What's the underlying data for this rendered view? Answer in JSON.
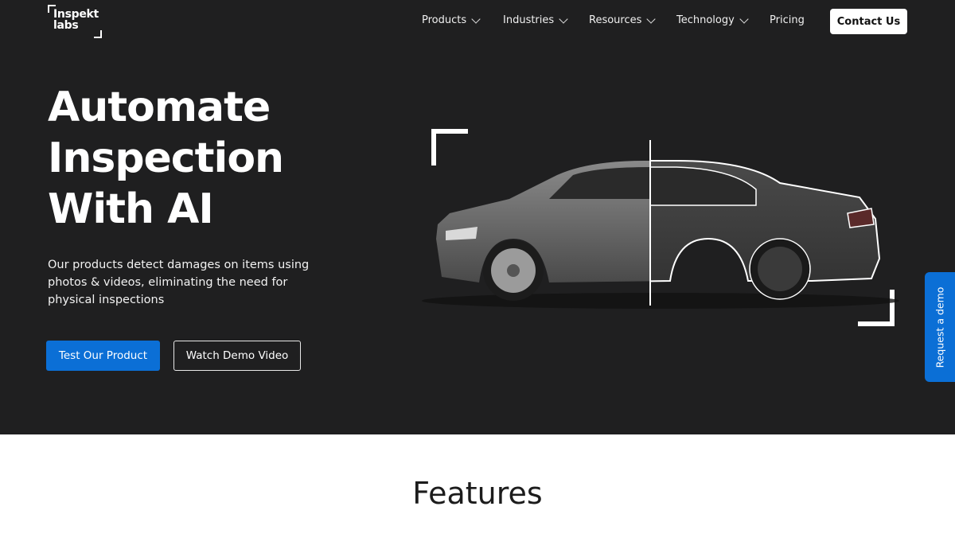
{
  "brand": {
    "logo_text_line1": "Inspekt",
    "logo_text_line2": "labs"
  },
  "nav": {
    "items": [
      {
        "label": "Products",
        "has_dropdown": true
      },
      {
        "label": "Industries",
        "has_dropdown": true
      },
      {
        "label": "Resources",
        "has_dropdown": true
      },
      {
        "label": "Technology",
        "has_dropdown": true
      },
      {
        "label": "Pricing",
        "has_dropdown": false
      }
    ],
    "cta_label": "Contact Us"
  },
  "hero": {
    "headline_lines": [
      "Automate",
      "Inspection",
      "With AI"
    ],
    "subtext": "Our products detect damages on items using photos & videos, eliminating the need for physical inspections",
    "primary_button": "Test Our Product",
    "secondary_button": "Watch Demo Video",
    "image_subject": "car-side-view-with-wireframe-overlay"
  },
  "side_tab": {
    "label": "Request a demo"
  },
  "section": {
    "title": "Features"
  },
  "colors": {
    "hero_bg": "#1f1f20",
    "accent_blue": "#0b6fd6",
    "white": "#ffffff"
  }
}
